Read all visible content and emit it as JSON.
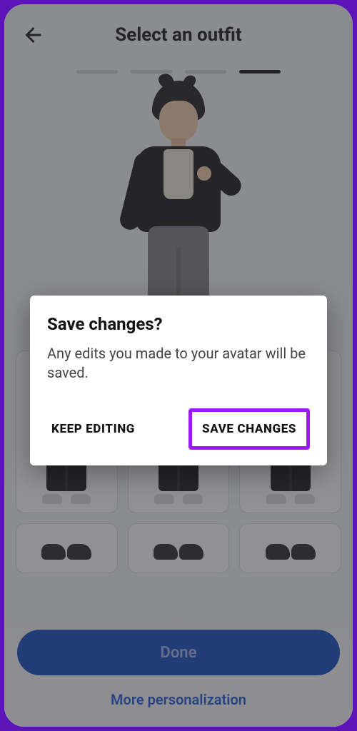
{
  "header": {
    "title": "Select an outfit"
  },
  "progress": {
    "total": 4,
    "active_index": 3
  },
  "dialog": {
    "title": "Save changes?",
    "body": "Any edits you made to your avatar will be saved.",
    "keep_label": "KEEP EDITING",
    "save_label": "SAVE CHANGES"
  },
  "actions": {
    "done_label": "Done",
    "more_label": "More personalization"
  },
  "colors": {
    "accent": "#9a19ff",
    "primary_button": "#0a43c2",
    "link": "#1556d6"
  }
}
